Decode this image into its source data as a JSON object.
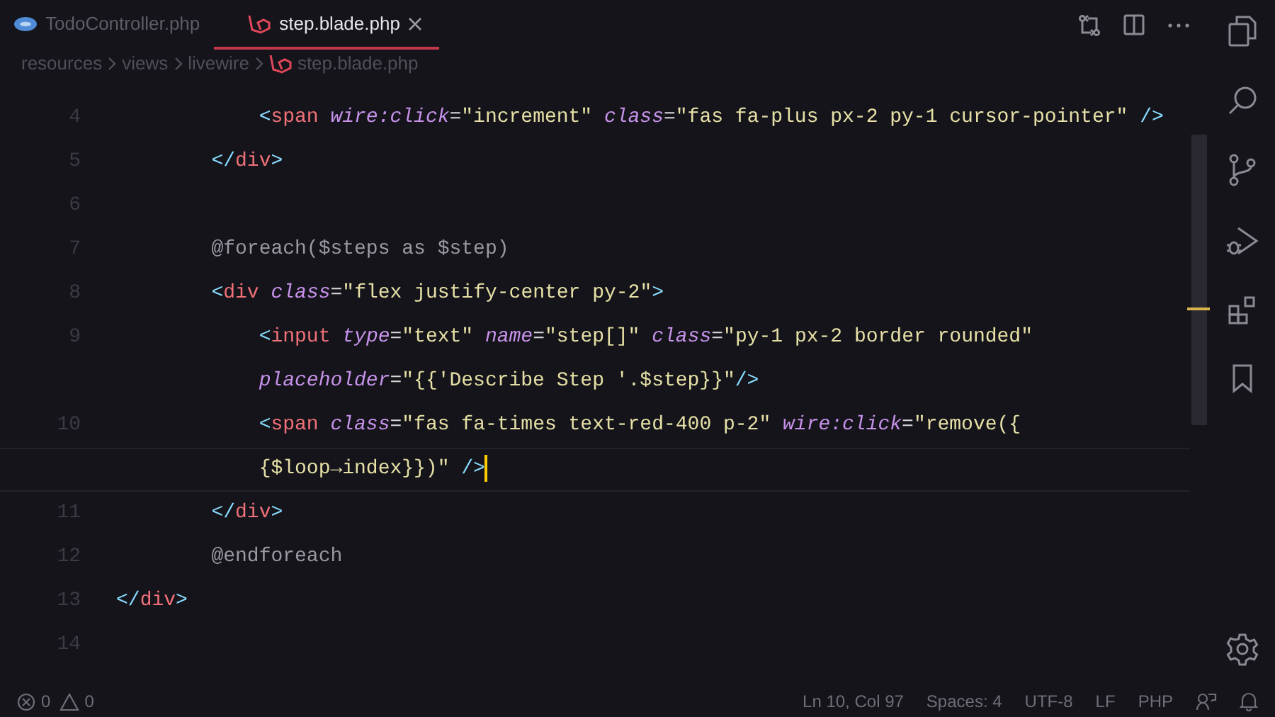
{
  "tabs": [
    {
      "label": "TodoController.php",
      "kind": "php",
      "selected": false
    },
    {
      "label": "step.blade.php",
      "kind": "blade",
      "selected": true
    }
  ],
  "breadcrumb": [
    "resources",
    "views",
    "livewire",
    "step.blade.php"
  ],
  "editor": {
    "lines": [
      {
        "number": "4",
        "current": false,
        "tokens": [
          {
            "kind": "bracket",
            "text": "            <"
          },
          {
            "kind": "tag",
            "text": "span"
          },
          {
            "kind": "attr",
            "text": " wire:click"
          },
          {
            "kind": "eq",
            "text": "="
          },
          {
            "kind": "string",
            "text": "\"increment\""
          },
          {
            "kind": "attr",
            "text": " class"
          },
          {
            "kind": "eq",
            "text": "="
          },
          {
            "kind": "string",
            "text": "\"fas fa-plus px-2 py-1 cursor-pointer\""
          },
          {
            "kind": "bracket",
            "text": " />"
          }
        ]
      },
      {
        "number": "5",
        "current": false,
        "tokens": [
          {
            "kind": "bracket",
            "text": "        </"
          },
          {
            "kind": "tag",
            "text": "div"
          },
          {
            "kind": "bracket",
            "text": ">"
          }
        ]
      },
      {
        "number": "6",
        "current": false
      },
      {
        "number": "7",
        "current": false,
        "tokens": [
          {
            "kind": "directive",
            "text": "        @foreach($steps as $step)"
          }
        ]
      },
      {
        "number": "8",
        "current": false,
        "tokens": [
          {
            "kind": "bracket",
            "text": "        <"
          },
          {
            "kind": "tag",
            "text": "div"
          },
          {
            "kind": "attr",
            "text": " class"
          },
          {
            "kind": "eq",
            "text": "="
          },
          {
            "kind": "string",
            "text": "\"flex justify-center py-2\""
          },
          {
            "kind": "bracket",
            "text": ">"
          }
        ]
      },
      {
        "number": "9",
        "current": false,
        "tokens": [
          {
            "kind": "bracket",
            "text": "            <"
          },
          {
            "kind": "tag",
            "text": "input"
          },
          {
            "kind": "attr",
            "text": " type"
          },
          {
            "kind": "eq",
            "text": "="
          },
          {
            "kind": "string",
            "text": "\"text\""
          },
          {
            "kind": "attr",
            "text": " name"
          },
          {
            "kind": "eq",
            "text": "="
          },
          {
            "kind": "string",
            "text": "\"step[]\""
          },
          {
            "kind": "attr",
            "text": " class"
          },
          {
            "kind": "eq",
            "text": "="
          },
          {
            "kind": "string",
            "text": "\"py-1 px-2 border rounded\""
          }
        ],
        "wrapped": [
          {
            "kind": "attr",
            "text": "            placeholder"
          },
          {
            "kind": "eq",
            "text": "="
          },
          {
            "kind": "string",
            "text": "\"{{'Describe Step '.$step}}\""
          },
          {
            "kind": "bracket",
            "text": "/>"
          }
        ]
      },
      {
        "number": "10",
        "current": true,
        "tokens": [
          {
            "kind": "bracket",
            "text": "            <"
          },
          {
            "kind": "tag",
            "text": "span"
          },
          {
            "kind": "attr",
            "text": " class"
          },
          {
            "kind": "eq",
            "text": "="
          },
          {
            "kind": "string",
            "text": "\"fas fa-times text-red-400 p-2\""
          },
          {
            "kind": "attr",
            "text": " wire:click"
          },
          {
            "kind": "eq",
            "text": "="
          },
          {
            "kind": "string",
            "text": "\"remove({"
          }
        ],
        "wrapped": [
          {
            "kind": "string",
            "text": "            {$loop→index}})\""
          },
          {
            "kind": "bracket",
            "text": " />"
          }
        ]
      },
      {
        "number": "11",
        "current": false,
        "tokens": [
          {
            "kind": "bracket",
            "text": "        </"
          },
          {
            "kind": "tag",
            "text": "div"
          },
          {
            "kind": "bracket",
            "text": ">"
          }
        ]
      },
      {
        "number": "12",
        "current": false,
        "tokens": [
          {
            "kind": "directive",
            "text": "        @endforeach"
          }
        ]
      },
      {
        "number": "13",
        "current": false,
        "tokens": [
          {
            "kind": "bracket",
            "text": "</"
          },
          {
            "kind": "tag",
            "text": "div"
          },
          {
            "kind": "bracket",
            "text": ">"
          }
        ]
      },
      {
        "number": "14",
        "current": false
      }
    ]
  },
  "status_bar": {
    "errors": "0",
    "warnings": "0",
    "items": [
      "Ln 10, Col 97",
      "Spaces: 4",
      "UTF-8",
      "LF",
      "PHP"
    ]
  }
}
